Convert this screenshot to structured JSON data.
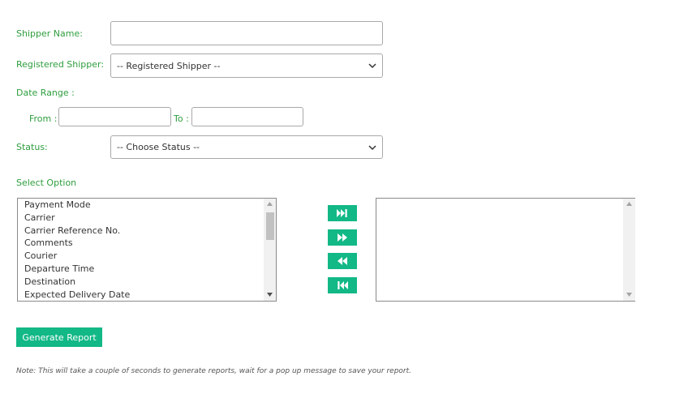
{
  "form": {
    "shipper_name_label": "Shipper Name:",
    "shipper_name_value": "",
    "registered_shipper_label": "Registered Shipper:",
    "registered_shipper_selected": "-- Registered Shipper --",
    "date_range_label": "Date Range :",
    "from_label": "From :",
    "from_value": "",
    "to_label": "To :",
    "to_value": "",
    "status_label": "Status:",
    "status_selected": "-- Choose Status --"
  },
  "select_option": {
    "label": "Select Option",
    "available": [
      "Payment Mode",
      "Carrier",
      "Carrier Reference No.",
      "Comments",
      "Courier",
      "Departure Time",
      "Destination",
      "Expected Delivery Date"
    ],
    "selected": [],
    "available_scroll_position": 0.08,
    "buttons": {
      "move_all_right": "fast-forward-end-icon",
      "move_right": "fast-forward-icon",
      "move_left": "rewind-icon",
      "move_all_left": "skip-to-start-icon"
    }
  },
  "actions": {
    "generate_report": "Generate Report"
  },
  "note": "Note: This will take a couple of seconds to generate reports, wait for a pop up message to save your report.",
  "colors": {
    "label_green": "#2e9e3e",
    "button_green": "#12b886"
  }
}
